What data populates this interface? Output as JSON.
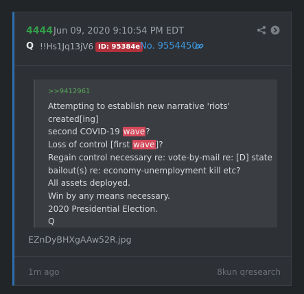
{
  "post": {
    "number": "4444",
    "date": "Jun 09, 2020 9:10:54 PM EDT",
    "author": "Q",
    "tripcode": "!!Hs1Jq13jV6",
    "id_badge": "ID: 95384e",
    "post_ref": "No. 9554450"
  },
  "quote": {
    "reply_ref": ">>9412961",
    "line1_a": "Attempting to establish new narrative 'riots' created[ing]",
    "line2_a": "second COVID-19 ",
    "line2_hl": "wave",
    "line2_b": "?",
    "line3_a": "Loss of control [first ",
    "line3_hl": "wave",
    "line3_b": "]?",
    "line4": "Regain control necessary re: vote-by-mail re: [D] state",
    "line5": "bailout(s) re: economy-unemployment kill etc?",
    "line6": "All assets deployed.",
    "line7": "Win by any means necessary.",
    "line8": "2020 Presidential Election.",
    "line9": "Q"
  },
  "attachment": {
    "filename": "EZnDyBHXgAAw52R.jpg"
  },
  "footer": {
    "time_ago": "1m ago",
    "source": "8kun qresearch"
  },
  "icons": {
    "share": "share-icon",
    "next": "arrow-right-circle-icon",
    "link": "link-icon"
  },
  "colors": {
    "background": "#222528",
    "card": "#2d3035",
    "accent_border": "#2f6fb0",
    "post_number": "#33a04a",
    "id_badge": "#b0303c",
    "link": "#3d97dc",
    "highlight": "#d4485a"
  }
}
